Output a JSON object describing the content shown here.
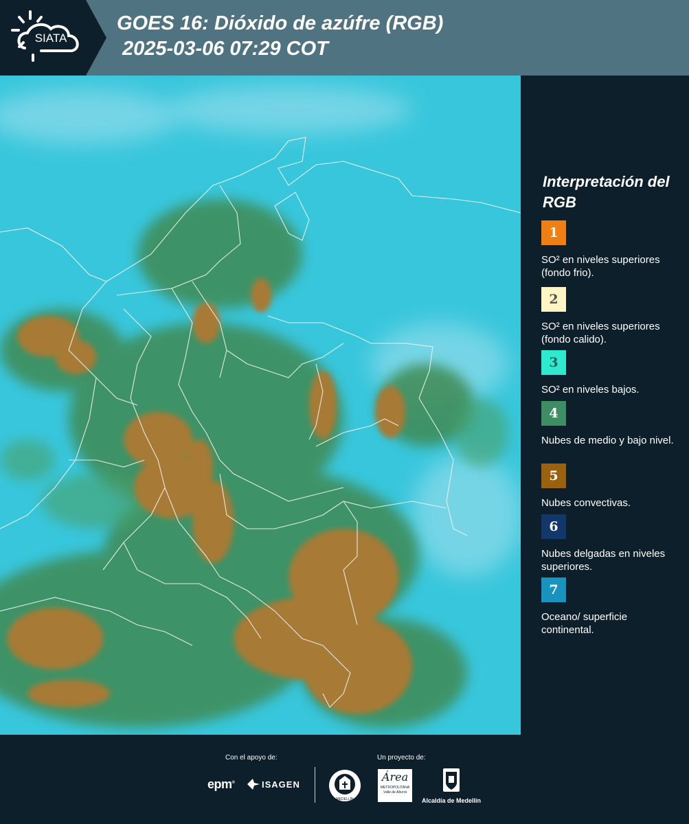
{
  "header": {
    "logo_text": "SIATA",
    "title": "GOES 16: Dióxido de azúfre (RGB)",
    "subtitle": "2025-03-06 07:29 COT"
  },
  "legend": {
    "title": "Interpretación del RGB",
    "items": [
      {
        "number": "1",
        "text": "SO² en niveles superiores (fondo frio).",
        "color": "#f07f13",
        "num_color": "#ffffff"
      },
      {
        "number": "2",
        "text": "SO² en niveles superiores (fondo calido).",
        "color": "#fdf5c4",
        "num_color": "#555555"
      },
      {
        "number": "3",
        "text": "SO² en niveles bajos.",
        "color": "#2fe9cf",
        "num_color": "#2a5d58"
      },
      {
        "number": "4",
        "text": "Nubes de medio y bajo nivel.",
        "color": "#3f8e63",
        "num_color": "#ffffff"
      },
      {
        "number": "5",
        "text": "Nubes convectivas.",
        "color": "#9a620f",
        "num_color": "#ffffff"
      },
      {
        "number": "6",
        "text": "Nubes delgadas en niveles superiores.",
        "color": "#12386b",
        "num_color": "#ffffff"
      },
      {
        "number": "7",
        "text": "Oceano/ superficie continental.",
        "color": "#1893bd",
        "num_color": "#ffffff"
      }
    ]
  },
  "footer": {
    "support_label": "Con el apoyo de:",
    "project_label": "Un proyecto de:",
    "epm": "epm",
    "isagen": "ISAGEN",
    "area_script": "Área",
    "area_line1": "METROPOLITANA",
    "area_line2": "Valle de Aburrá",
    "alcaldia": "Alcaldía de Medellín",
    "seal_text": "MEDELLÍN"
  }
}
